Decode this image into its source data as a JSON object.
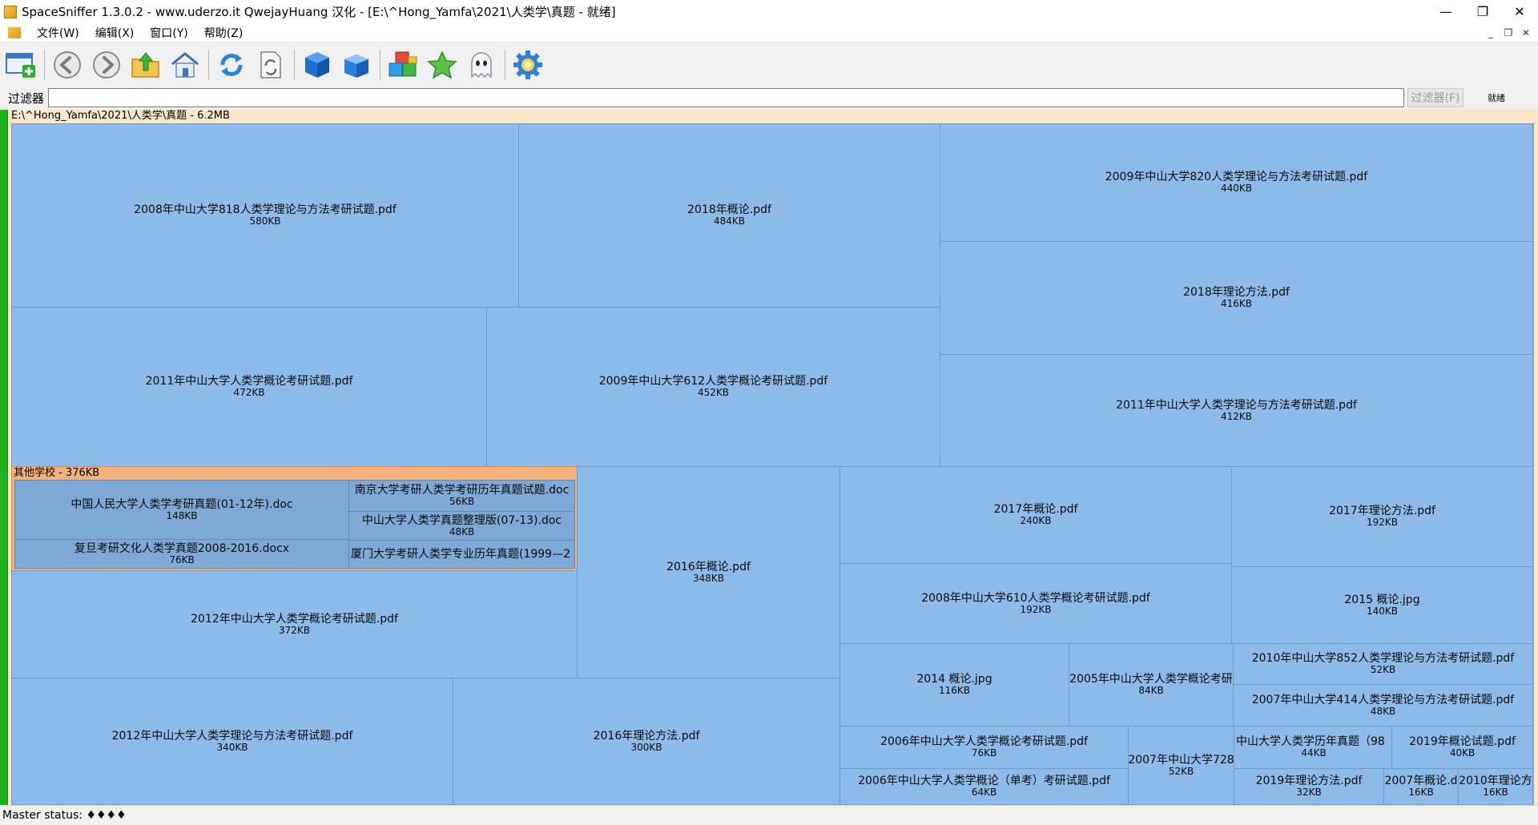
{
  "window": {
    "title": "SpaceSniffer 1.3.0.2 - www.uderzo.it  QwejayHuang 汉化 - [E:\\^Hong_Yamfa\\2021\\人类学\\真题 - 就绪]",
    "minimize": "—",
    "maximize": "❐",
    "close": "✕"
  },
  "menu": {
    "items": [
      "文件(W)",
      "编辑(X)",
      "窗口(Y)",
      "帮助(Z)"
    ],
    "mdi_min": "_",
    "mdi_restore": "❐",
    "mdi_close": "✕"
  },
  "toolbar": {
    "icons": [
      "new-scan-icon",
      "back-icon",
      "forward-icon",
      "up-folder-icon",
      "home-icon",
      "refresh-icon",
      "refresh-page-icon",
      "blue-box-icon",
      "blue-box-open-icon",
      "cubes-icon",
      "star-icon",
      "ghost-icon",
      "gear-icon"
    ]
  },
  "filter": {
    "label": "过滤器",
    "value": "",
    "button": "过滤器(F)",
    "status": "就绪"
  },
  "colors": {
    "tile": "#8dbbe9",
    "folder": "#f4b27a",
    "root_header": "#fbe6c8",
    "green_bar": "#1fb21f"
  },
  "treemap": {
    "root_label": "E:\\^Hong_Yamfa\\2021\\人类学\\真题 - 6.2MB",
    "folder": {
      "label": "其他学校 - 376KB",
      "items": [
        {
          "name": "中国人民大学人类学考研真题(01-12年).doc",
          "size": "148KB"
        },
        {
          "name": "复旦考研文化人类学真题2008-2016.docx",
          "size": "76KB"
        },
        {
          "name": "南京大学考研人类学考研历年真题试题.doc",
          "size": "56KB"
        },
        {
          "name": "中山大学人类学真题整理版(07-13).doc",
          "size": "48KB"
        },
        {
          "name": "厦门大学考研人类学专业历年真题(1999—2",
          "size": ""
        }
      ]
    },
    "files": [
      {
        "name": "2008年中山大学818人类学理论与方法考研试题.pdf",
        "size": "580KB"
      },
      {
        "name": "2018年概论.pdf",
        "size": "484KB"
      },
      {
        "name": "2009年中山大学820人类学理论与方法考研试题.pdf",
        "size": "440KB"
      },
      {
        "name": "2018年理论方法.pdf",
        "size": "416KB"
      },
      {
        "name": "2011年中山大学人类学概论考研试题.pdf",
        "size": "472KB"
      },
      {
        "name": "2009年中山大学612人类学概论考研试题.pdf",
        "size": "452KB"
      },
      {
        "name": "2011年中山大学人类学理论与方法考研试题.pdf",
        "size": "412KB"
      },
      {
        "name": "2016年概论.pdf",
        "size": "348KB"
      },
      {
        "name": "2017年概论.pdf",
        "size": "240KB"
      },
      {
        "name": "2017年理论方法.pdf",
        "size": "192KB"
      },
      {
        "name": "2008年中山大学610人类学概论考研试题.pdf",
        "size": "192KB"
      },
      {
        "name": "2015 概论.jpg",
        "size": "140KB"
      },
      {
        "name": "2012年中山大学人类学概论考研试题.pdf",
        "size": "372KB"
      },
      {
        "name": "2014 概论.jpg",
        "size": "116KB"
      },
      {
        "name": "2005年中山大学人类学概论考研",
        "size": "84KB"
      },
      {
        "name": "2010年中山大学852人类学理论与方法考研试题.pdf",
        "size": "52KB"
      },
      {
        "name": "2007年中山大学414人类学理论与方法考研试题.pdf",
        "size": "48KB"
      },
      {
        "name": "2012年中山大学人类学理论与方法考研试题.pdf",
        "size": "340KB"
      },
      {
        "name": "2016年理论方法.pdf",
        "size": "300KB"
      },
      {
        "name": "2006年中山大学人类学概论考研试题.pdf",
        "size": "76KB"
      },
      {
        "name": "2007年中山大学728",
        "size": "52KB"
      },
      {
        "name": "中山大学人类学历年真题（98",
        "size": "44KB"
      },
      {
        "name": "2019年概论试题.pdf",
        "size": "40KB"
      },
      {
        "name": "2006年中山大学人类学概论（单考）考研试题.pdf",
        "size": "64KB"
      },
      {
        "name": "2019年理论方法.pdf",
        "size": "32KB"
      },
      {
        "name": "2007年概论.d",
        "size": "16KB"
      },
      {
        "name": "2010年理论方",
        "size": "16KB"
      }
    ]
  },
  "statusbar": {
    "text": "Master status: ♦♦♦♦"
  }
}
